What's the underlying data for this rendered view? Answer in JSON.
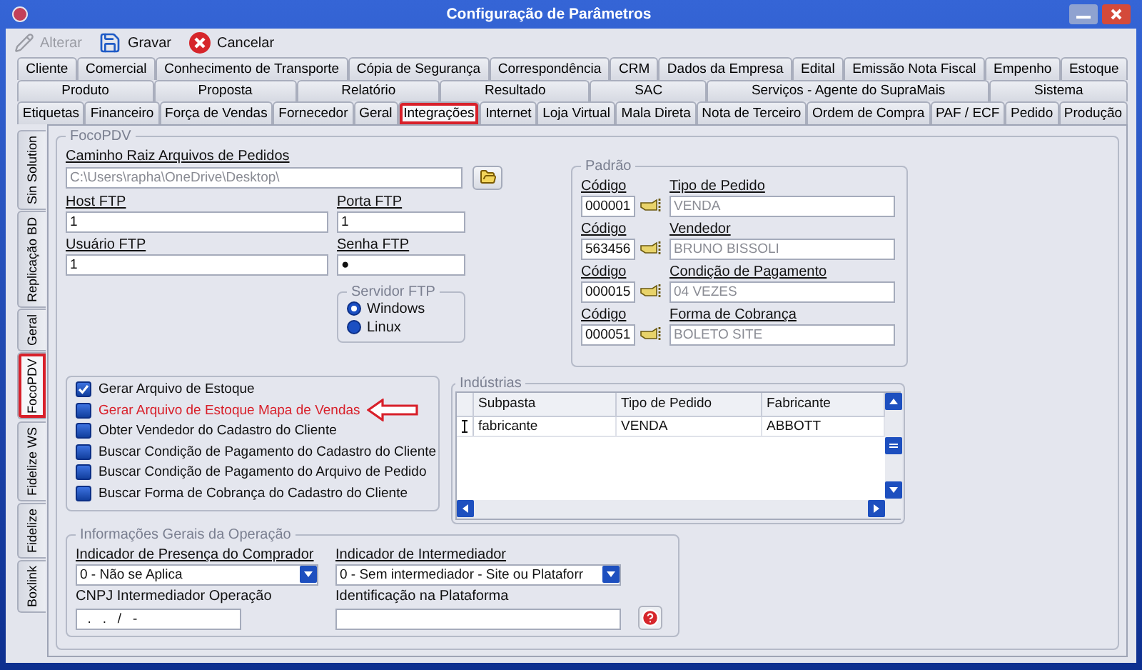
{
  "window": {
    "title": "Configuração de Parâmetros"
  },
  "toolbar": [
    {
      "kind": "edit",
      "label": "Alterar",
      "disabled": true
    },
    {
      "kind": "save",
      "label": "Gravar",
      "disabled": false
    },
    {
      "kind": "cancel",
      "label": "Cancelar",
      "disabled": false
    }
  ],
  "tab_rows": [
    [
      {
        "label": "Cliente",
        "selected": false,
        "highlighted": false
      },
      {
        "label": "Comercial",
        "selected": false,
        "highlighted": false
      },
      {
        "label": "Conhecimento de Transporte",
        "selected": false,
        "highlighted": false
      },
      {
        "label": "Cópia de Segurança",
        "selected": false,
        "highlighted": false
      },
      {
        "label": "Correspondência",
        "selected": false,
        "highlighted": false
      },
      {
        "label": "CRM",
        "selected": false,
        "highlighted": false
      },
      {
        "label": "Dados da Empresa",
        "selected": false,
        "highlighted": false
      },
      {
        "label": "Edital",
        "selected": false,
        "highlighted": false
      },
      {
        "label": "Emissão Nota Fiscal",
        "selected": false,
        "highlighted": false
      },
      {
        "label": "Empenho",
        "selected": false,
        "highlighted": false
      },
      {
        "label": "Estoque",
        "selected": false,
        "highlighted": false
      }
    ],
    [
      {
        "label": "Produto",
        "selected": false,
        "highlighted": false
      },
      {
        "label": "Proposta",
        "selected": false,
        "highlighted": false
      },
      {
        "label": "Relatório",
        "selected": false,
        "highlighted": false
      },
      {
        "label": "Resultado",
        "selected": false,
        "highlighted": false
      },
      {
        "label": "SAC",
        "selected": false,
        "highlighted": false
      },
      {
        "label": "Serviços - Agente do SupraMais",
        "selected": false,
        "highlighted": false
      },
      {
        "label": "Sistema",
        "selected": false,
        "highlighted": false
      }
    ],
    [
      {
        "label": "Etiquetas",
        "selected": false,
        "highlighted": false
      },
      {
        "label": "Financeiro",
        "selected": false,
        "highlighted": false
      },
      {
        "label": "Força de Vendas",
        "selected": false,
        "highlighted": false
      },
      {
        "label": "Fornecedor",
        "selected": false,
        "highlighted": false
      },
      {
        "label": "Geral",
        "selected": false,
        "highlighted": false
      },
      {
        "label": "Integrações",
        "selected": true,
        "highlighted": true
      },
      {
        "label": "Internet",
        "selected": false,
        "highlighted": false
      },
      {
        "label": "Loja Virtual",
        "selected": false,
        "highlighted": false
      },
      {
        "label": "Mala Direta",
        "selected": false,
        "highlighted": false
      },
      {
        "label": "Nota de Terceiro",
        "selected": false,
        "highlighted": false
      },
      {
        "label": "Ordem de Compra",
        "selected": false,
        "highlighted": false
      },
      {
        "label": "PAF / ECF",
        "selected": false,
        "highlighted": false
      },
      {
        "label": "Pedido",
        "selected": false,
        "highlighted": false
      },
      {
        "label": "Produção",
        "selected": false,
        "highlighted": false
      }
    ]
  ],
  "side_tabs": [
    {
      "label": "Sin Solution",
      "selected": false,
      "highlighted": false
    },
    {
      "label": "Replicação BD",
      "selected": false,
      "highlighted": false
    },
    {
      "label": "Geral",
      "selected": false,
      "highlighted": false
    },
    {
      "label": "FocoPDV",
      "selected": true,
      "highlighted": true
    },
    {
      "label": "Fidelize WS",
      "selected": false,
      "highlighted": false
    },
    {
      "label": "Fidelize",
      "selected": false,
      "highlighted": false
    },
    {
      "label": "Boxlink",
      "selected": false,
      "highlighted": false
    }
  ],
  "focopdv": {
    "title": "FocoPDV",
    "path_label": "Caminho Raiz Arquivos de Pedidos",
    "path_value": "C:\\Users\\rapha\\OneDrive\\Desktop\\",
    "host_label": "Host FTP",
    "host_value": "1",
    "port_label": "Porta FTP",
    "port_value": "1",
    "user_label": "Usuário FTP",
    "user_value": "1",
    "password_label": "Senha FTP",
    "password_value": "●",
    "server": {
      "title": "Servidor FTP",
      "options": [
        {
          "label": "Windows",
          "selected": true
        },
        {
          "label": "Linux",
          "selected": false
        }
      ]
    }
  },
  "padrao": {
    "title": "Padrão",
    "rows": [
      {
        "code_label": "Código",
        "code": "000001",
        "name_label": "Tipo de Pedido",
        "name": "VENDA"
      },
      {
        "code_label": "Código",
        "code": "563456",
        "name_label": "Vendedor",
        "name": "BRUNO BISSOLI"
      },
      {
        "code_label": "Código",
        "code": "000015",
        "name_label": "Condição de Pagamento",
        "name": "04 VEZES"
      },
      {
        "code_label": "Código",
        "code": "000051",
        "name_label": "Forma de Cobrança",
        "name": "BOLETO SITE"
      }
    ]
  },
  "options": [
    {
      "label": "Gerar Arquivo de Estoque",
      "checked": true,
      "highlighted": false
    },
    {
      "label": "Gerar Arquivo de Estoque Mapa de Vendas",
      "checked": false,
      "highlighted": true
    },
    {
      "label": "Obter Vendedor do Cadastro do Cliente",
      "checked": false,
      "highlighted": false
    },
    {
      "label": "Buscar Condição de Pagamento do Cadastro do Cliente",
      "checked": false,
      "highlighted": false
    },
    {
      "label": "Buscar Condição de Pagamento do Arquivo de Pedido",
      "checked": false,
      "highlighted": false
    },
    {
      "label": "Buscar Forma de Cobrança do Cadastro do Cliente",
      "checked": false,
      "highlighted": false
    }
  ],
  "industrias": {
    "title": "Indústrias",
    "columns": [
      "Subpasta",
      "Tipo de Pedido",
      "Fabricante"
    ],
    "rows": [
      {
        "cells": [
          "fabricante",
          "VENDA",
          "ABBOTT"
        ]
      }
    ]
  },
  "info": {
    "title": "Informações Gerais da Operação",
    "presence_label": "Indicador de Presença do Comprador",
    "presence_value": "0 - Não se Aplica",
    "intermediary_label": "Indicador de Intermediador",
    "intermediary_value": "0 - Sem intermediador - Site ou Plataforr",
    "cnpj_label": "CNPJ Intermediador Operação",
    "cnpj_value": "  .   .   /   -",
    "platform_label": "Identificação na Plataforma"
  }
}
